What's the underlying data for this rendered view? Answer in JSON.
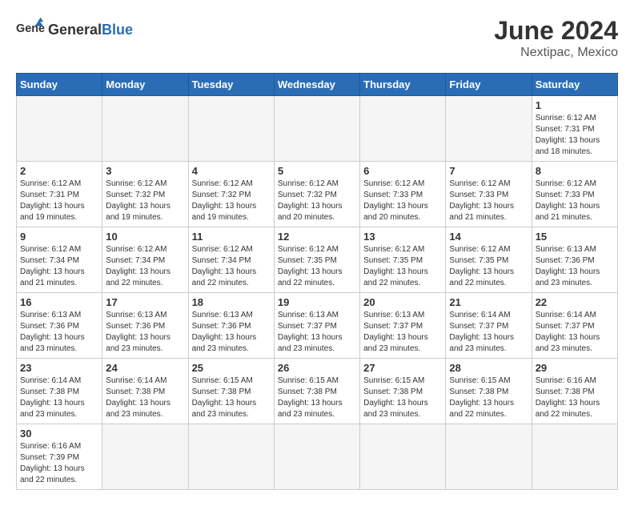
{
  "header": {
    "logo_general": "General",
    "logo_blue": "Blue",
    "month_year": "June 2024",
    "location": "Nextipac, Mexico"
  },
  "weekdays": [
    "Sunday",
    "Monday",
    "Tuesday",
    "Wednesday",
    "Thursday",
    "Friday",
    "Saturday"
  ],
  "weeks": [
    [
      {
        "day": "",
        "info": ""
      },
      {
        "day": "",
        "info": ""
      },
      {
        "day": "",
        "info": ""
      },
      {
        "day": "",
        "info": ""
      },
      {
        "day": "",
        "info": ""
      },
      {
        "day": "",
        "info": ""
      },
      {
        "day": "1",
        "info": "Sunrise: 6:12 AM\nSunset: 7:31 PM\nDaylight: 13 hours and 18 minutes."
      }
    ],
    [
      {
        "day": "2",
        "info": "Sunrise: 6:12 AM\nSunset: 7:31 PM\nDaylight: 13 hours and 19 minutes."
      },
      {
        "day": "3",
        "info": "Sunrise: 6:12 AM\nSunset: 7:32 PM\nDaylight: 13 hours and 19 minutes."
      },
      {
        "day": "4",
        "info": "Sunrise: 6:12 AM\nSunset: 7:32 PM\nDaylight: 13 hours and 19 minutes."
      },
      {
        "day": "5",
        "info": "Sunrise: 6:12 AM\nSunset: 7:32 PM\nDaylight: 13 hours and 20 minutes."
      },
      {
        "day": "6",
        "info": "Sunrise: 6:12 AM\nSunset: 7:33 PM\nDaylight: 13 hours and 20 minutes."
      },
      {
        "day": "7",
        "info": "Sunrise: 6:12 AM\nSunset: 7:33 PM\nDaylight: 13 hours and 21 minutes."
      },
      {
        "day": "8",
        "info": "Sunrise: 6:12 AM\nSunset: 7:33 PM\nDaylight: 13 hours and 21 minutes."
      }
    ],
    [
      {
        "day": "9",
        "info": "Sunrise: 6:12 AM\nSunset: 7:34 PM\nDaylight: 13 hours and 21 minutes."
      },
      {
        "day": "10",
        "info": "Sunrise: 6:12 AM\nSunset: 7:34 PM\nDaylight: 13 hours and 22 minutes."
      },
      {
        "day": "11",
        "info": "Sunrise: 6:12 AM\nSunset: 7:34 PM\nDaylight: 13 hours and 22 minutes."
      },
      {
        "day": "12",
        "info": "Sunrise: 6:12 AM\nSunset: 7:35 PM\nDaylight: 13 hours and 22 minutes."
      },
      {
        "day": "13",
        "info": "Sunrise: 6:12 AM\nSunset: 7:35 PM\nDaylight: 13 hours and 22 minutes."
      },
      {
        "day": "14",
        "info": "Sunrise: 6:12 AM\nSunset: 7:35 PM\nDaylight: 13 hours and 22 minutes."
      },
      {
        "day": "15",
        "info": "Sunrise: 6:13 AM\nSunset: 7:36 PM\nDaylight: 13 hours and 23 minutes."
      }
    ],
    [
      {
        "day": "16",
        "info": "Sunrise: 6:13 AM\nSunset: 7:36 PM\nDaylight: 13 hours and 23 minutes."
      },
      {
        "day": "17",
        "info": "Sunrise: 6:13 AM\nSunset: 7:36 PM\nDaylight: 13 hours and 23 minutes."
      },
      {
        "day": "18",
        "info": "Sunrise: 6:13 AM\nSunset: 7:36 PM\nDaylight: 13 hours and 23 minutes."
      },
      {
        "day": "19",
        "info": "Sunrise: 6:13 AM\nSunset: 7:37 PM\nDaylight: 13 hours and 23 minutes."
      },
      {
        "day": "20",
        "info": "Sunrise: 6:13 AM\nSunset: 7:37 PM\nDaylight: 13 hours and 23 minutes."
      },
      {
        "day": "21",
        "info": "Sunrise: 6:14 AM\nSunset: 7:37 PM\nDaylight: 13 hours and 23 minutes."
      },
      {
        "day": "22",
        "info": "Sunrise: 6:14 AM\nSunset: 7:37 PM\nDaylight: 13 hours and 23 minutes."
      }
    ],
    [
      {
        "day": "23",
        "info": "Sunrise: 6:14 AM\nSunset: 7:38 PM\nDaylight: 13 hours and 23 minutes."
      },
      {
        "day": "24",
        "info": "Sunrise: 6:14 AM\nSunset: 7:38 PM\nDaylight: 13 hours and 23 minutes."
      },
      {
        "day": "25",
        "info": "Sunrise: 6:15 AM\nSunset: 7:38 PM\nDaylight: 13 hours and 23 minutes."
      },
      {
        "day": "26",
        "info": "Sunrise: 6:15 AM\nSunset: 7:38 PM\nDaylight: 13 hours and 23 minutes."
      },
      {
        "day": "27",
        "info": "Sunrise: 6:15 AM\nSunset: 7:38 PM\nDaylight: 13 hours and 23 minutes."
      },
      {
        "day": "28",
        "info": "Sunrise: 6:15 AM\nSunset: 7:38 PM\nDaylight: 13 hours and 22 minutes."
      },
      {
        "day": "29",
        "info": "Sunrise: 6:16 AM\nSunset: 7:38 PM\nDaylight: 13 hours and 22 minutes."
      }
    ],
    [
      {
        "day": "30",
        "info": "Sunrise: 6:16 AM\nSunset: 7:39 PM\nDaylight: 13 hours and 22 minutes."
      },
      {
        "day": "",
        "info": ""
      },
      {
        "day": "",
        "info": ""
      },
      {
        "day": "",
        "info": ""
      },
      {
        "day": "",
        "info": ""
      },
      {
        "day": "",
        "info": ""
      },
      {
        "day": "",
        "info": ""
      }
    ]
  ]
}
